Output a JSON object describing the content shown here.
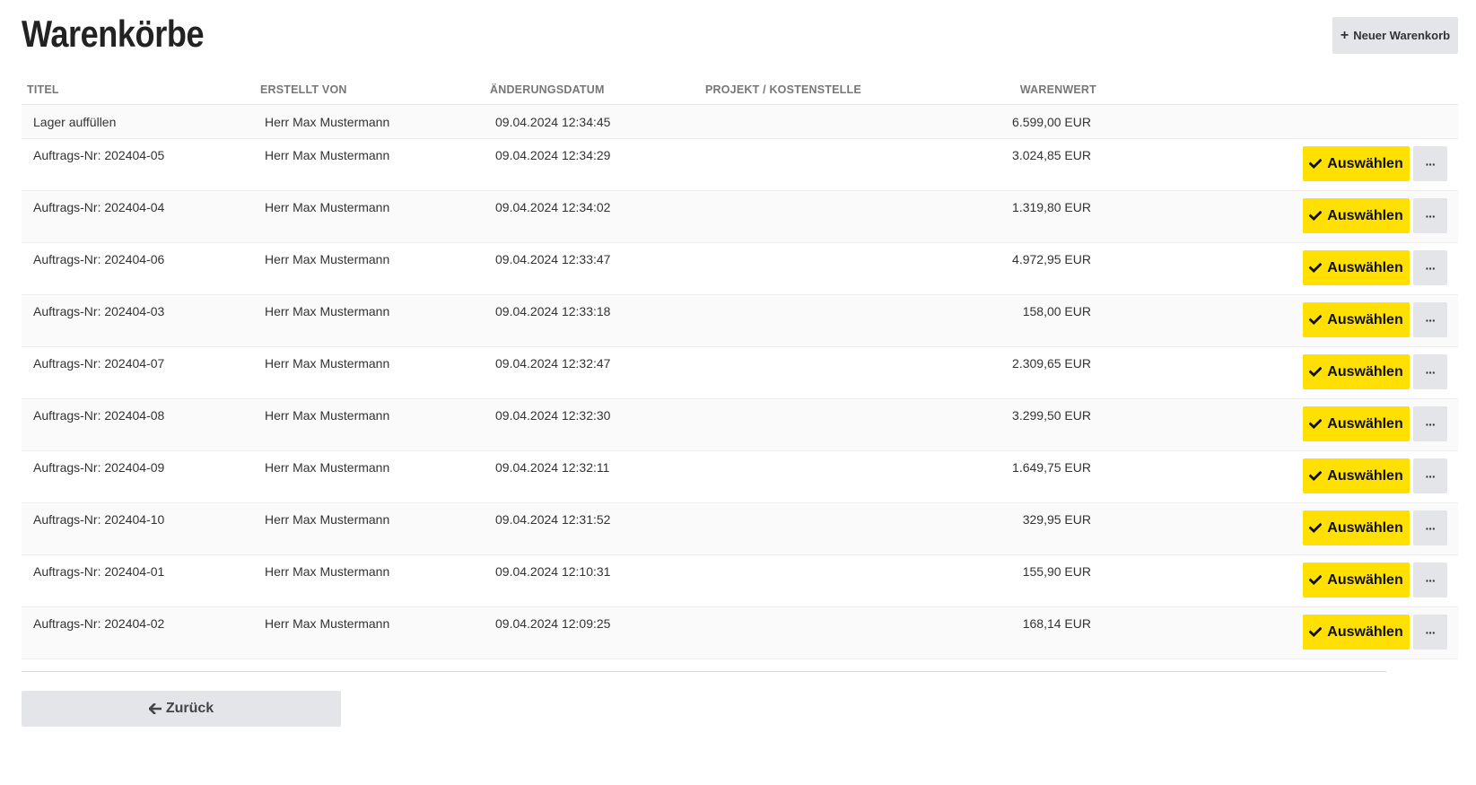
{
  "header": {
    "title": "Warenkörbe",
    "new_cart_label": "Neuer Warenkorb",
    "new_cart_icon": "plus-icon"
  },
  "table": {
    "columns": {
      "title": "TITEL",
      "created_by": "ERSTELLT VON",
      "modified": "ÄNDERUNGSDATUM",
      "project": "PROJEKT / KOSTENSTELLE",
      "value": "WARENWERT"
    },
    "rows": [
      {
        "title": "Lager auffüllen",
        "created_by": "Herr Max Mustermann",
        "modified": "09.04.2024 12:34:45",
        "project": "",
        "value": "6.599,00 EUR",
        "has_actions": false
      },
      {
        "title": "Auftrags-Nr: 202404-05",
        "created_by": "Herr Max Mustermann",
        "modified": "09.04.2024 12:34:29",
        "project": "",
        "value": "3.024,85 EUR",
        "has_actions": true
      },
      {
        "title": "Auftrags-Nr: 202404-04",
        "created_by": "Herr Max Mustermann",
        "modified": "09.04.2024 12:34:02",
        "project": "",
        "value": "1.319,80 EUR",
        "has_actions": true
      },
      {
        "title": "Auftrags-Nr: 202404-06",
        "created_by": "Herr Max Mustermann",
        "modified": "09.04.2024 12:33:47",
        "project": "",
        "value": "4.972,95 EUR",
        "has_actions": true
      },
      {
        "title": "Auftrags-Nr: 202404-03",
        "created_by": "Herr Max Mustermann",
        "modified": "09.04.2024 12:33:18",
        "project": "",
        "value": "158,00 EUR",
        "has_actions": true
      },
      {
        "title": "Auftrags-Nr: 202404-07",
        "created_by": "Herr Max Mustermann",
        "modified": "09.04.2024 12:32:47",
        "project": "",
        "value": "2.309,65 EUR",
        "has_actions": true
      },
      {
        "title": "Auftrags-Nr: 202404-08",
        "created_by": "Herr Max Mustermann",
        "modified": "09.04.2024 12:32:30",
        "project": "",
        "value": "3.299,50 EUR",
        "has_actions": true
      },
      {
        "title": "Auftrags-Nr: 202404-09",
        "created_by": "Herr Max Mustermann",
        "modified": "09.04.2024 12:32:11",
        "project": "",
        "value": "1.649,75 EUR",
        "has_actions": true
      },
      {
        "title": "Auftrags-Nr: 202404-10",
        "created_by": "Herr Max Mustermann",
        "modified": "09.04.2024 12:31:52",
        "project": "",
        "value": "329,95 EUR",
        "has_actions": true
      },
      {
        "title": "Auftrags-Nr: 202404-01",
        "created_by": "Herr Max Mustermann",
        "modified": "09.04.2024 12:10:31",
        "project": "",
        "value": "155,90 EUR",
        "has_actions": true
      },
      {
        "title": "Auftrags-Nr: 202404-02",
        "created_by": "Herr Max Mustermann",
        "modified": "09.04.2024 12:09:25",
        "project": "",
        "value": "168,14 EUR",
        "has_actions": true
      }
    ],
    "select_label": "Auswählen",
    "select_icon": "check-icon",
    "more_label": "···",
    "more_icon": "ellipsis-icon"
  },
  "footer": {
    "back_label": "Zurück",
    "back_icon": "arrow-left-icon"
  },
  "colors": {
    "accent": "#ffe000",
    "button_gray": "#e3e5e8"
  }
}
